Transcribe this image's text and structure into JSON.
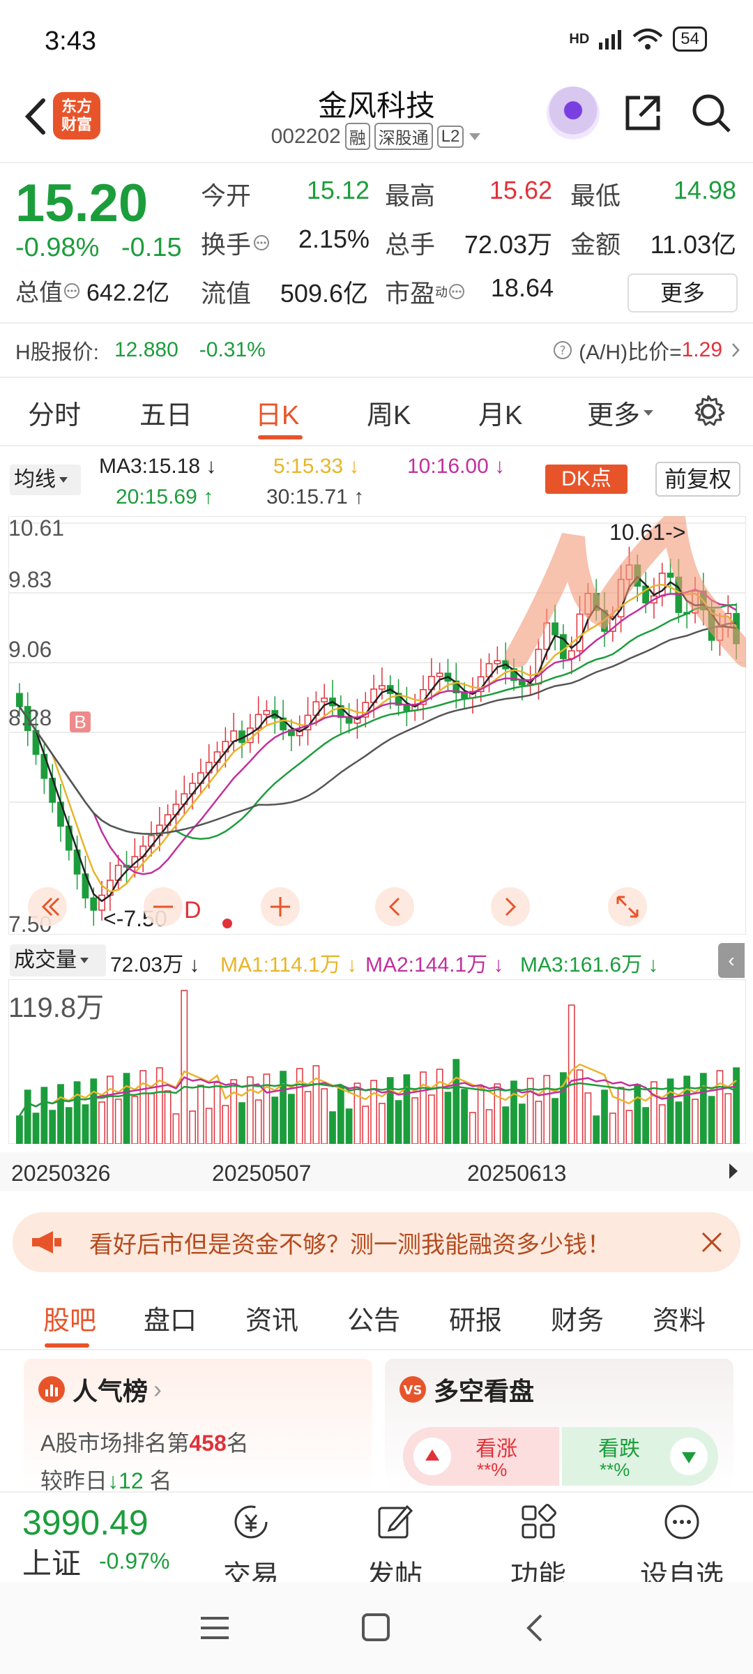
{
  "status": {
    "time": "3:43",
    "network": "HD",
    "battery": "54"
  },
  "header": {
    "logo_line1": "东方",
    "logo_line2": "财富",
    "stock_name": "金风科技",
    "stock_code": "002202",
    "tags": [
      "融",
      "深股通",
      "L2"
    ]
  },
  "quote": {
    "price": "15.20",
    "change_pct": "-0.98%",
    "change": "-0.15",
    "open_label": "今开",
    "open": "15.12",
    "high_label": "最高",
    "high": "15.62",
    "low_label": "最低",
    "low": "14.98",
    "turnover_label": "换手",
    "turnover": "2.15%",
    "volume_label": "总手",
    "volume": "72.03万",
    "amount_label": "金额",
    "amount": "11.03亿",
    "mktcap_label": "总值",
    "mktcap": "642.2亿",
    "float_label": "流值",
    "float_cap": "509.6亿",
    "pe_label": "市盈",
    "pe_sup": "动",
    "pe": "18.64",
    "more": "更多"
  },
  "hshare": {
    "label": "H股报价:",
    "price": "12.880",
    "pct": "-0.31%",
    "ah_label": "(A/H)比价=",
    "ah_value": "1.29"
  },
  "period_tabs": [
    "分时",
    "五日",
    "日K",
    "周K",
    "月K",
    "更多"
  ],
  "period_active": 2,
  "ma": {
    "select": "均线",
    "ma3": "MA3:15.18",
    "ma5": "5:15.33",
    "ma10": "10:16.00",
    "ma20": "20:15.69",
    "ma30": "30:15.71",
    "dk": "DK点",
    "fq": "前复权"
  },
  "chart_data": {
    "type": "candlestick",
    "price_labels": [
      "10.61",
      "9.83",
      "9.06",
      "8.28",
      "7.50"
    ],
    "high_marker": "10.61->",
    "low_marker": "<-7.50",
    "markers": [
      "B",
      "D"
    ],
    "volume_max_label": "119.8万",
    "dates": [
      "20250326",
      "20250507",
      "20250613"
    ]
  },
  "volume": {
    "select": "成交量",
    "vol": "72.03万",
    "ma1": "MA1:114.1万",
    "ma2": "MA2:144.1万",
    "ma3": "MA3:161.6万"
  },
  "banner": {
    "text": "看好后市但是资金不够？测一测我能融资多少钱！"
  },
  "news_tabs": [
    "股吧",
    "盘口",
    "资讯",
    "公告",
    "研报",
    "财务",
    "资料"
  ],
  "news_active": 0,
  "card_rank": {
    "title": "人气榜",
    "line1_prefix": "A股市场排名第",
    "line1_num": "458",
    "line1_suffix": "名",
    "line2_prefix": "较昨日",
    "line2_num": "12",
    "line2_suffix": "名"
  },
  "card_bull": {
    "title": "多空看盘",
    "up_label": "看涨",
    "up_value": "**%",
    "down_label": "看跌",
    "down_value": "**%"
  },
  "bottom": {
    "index_value": "3990.49",
    "index_name": "上证",
    "index_pct": "-0.97%",
    "trade": "交易",
    "post": "发帖",
    "func": "功能",
    "watch": "设自选"
  },
  "colors": {
    "up": "#e0323a",
    "down": "#1c9d3c",
    "accent": "#e8542a"
  }
}
